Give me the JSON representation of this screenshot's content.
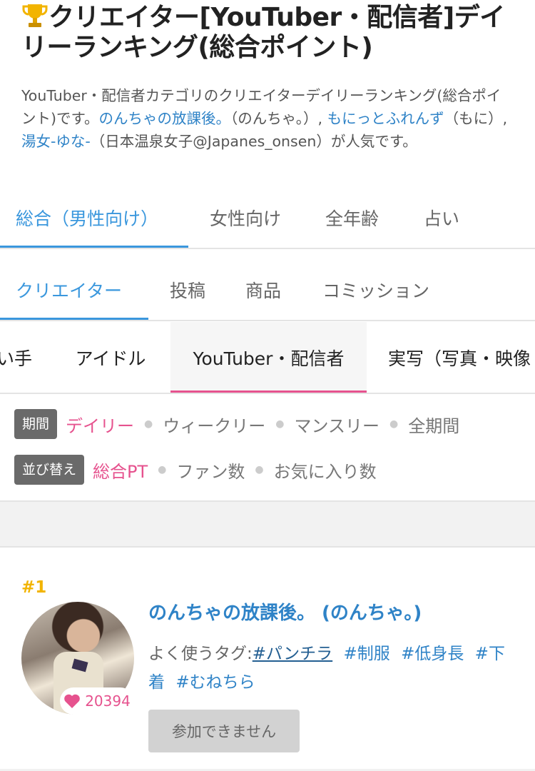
{
  "page": {
    "title": "クリエイター[YouTuber・配信者]デイリーランキング(総合ポイント)",
    "description_prefix": "YouTuber・配信者カテゴリのクリエイターデイリーランキング(総合ポイント)です。",
    "creator_links": [
      {
        "name": "のんちゃの放課後。",
        "suffix": "（のんちゃ。）, "
      },
      {
        "name": "もにっとふれんず",
        "suffix": "（もに）, "
      },
      {
        "name": "湯女-ゆな-",
        "suffix": "（日本温泉女子@Japanes_onsen）"
      }
    ],
    "description_suffix": "が人気です。"
  },
  "tabs_audience": [
    "総合（男性向け）",
    "女性向け",
    "全年齢",
    "占い"
  ],
  "tabs_type": [
    "クリエイター",
    "投稿",
    "商品",
    "コミッション"
  ],
  "tabs_category": [
    "い手",
    "アイドル",
    "YouTuber・配信者",
    "実写（写真・映像"
  ],
  "filters": {
    "period_label": "期間",
    "period_options": [
      "デイリー",
      "ウィークリー",
      "マンスリー",
      "全期間"
    ],
    "sort_label": "並び替え",
    "sort_options": [
      "総合PT",
      "ファン数",
      "お気に入り数"
    ]
  },
  "ranking": [
    {
      "rank": "#1",
      "name": "のんちゃの放課後。 (のんちゃ。)",
      "favorites": "20394",
      "tags_label": "よく使うタグ:",
      "tags": [
        "#パンチラ",
        "#制服",
        "#低身長",
        "#下着",
        "#むねちら"
      ],
      "button": "参加できません"
    }
  ],
  "colors": {
    "accent_blue": "#3a97dd",
    "accent_pink": "#e6528e",
    "rank_gold": "#f2b400"
  },
  "icons": [
    "trophy-icon",
    "heart-icon"
  ]
}
